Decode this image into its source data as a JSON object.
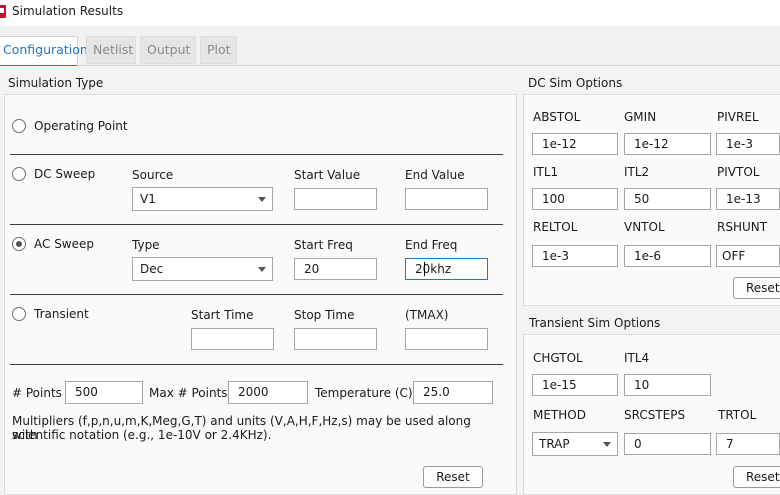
{
  "window": {
    "title": "Simulation Results"
  },
  "tabs": [
    "Configuration",
    "Netlist",
    "Output",
    "Plot"
  ],
  "sim_type": {
    "heading": "Simulation Type",
    "op_point": {
      "label": "Operating Point"
    },
    "dc_sweep": {
      "label": "DC Sweep",
      "source_label": "Source",
      "source_value": "V1",
      "start_label": "Start Value",
      "start_value": "",
      "end_label": "End Value",
      "end_value": ""
    },
    "ac_sweep": {
      "label": "AC Sweep",
      "selected": true,
      "type_label": "Type",
      "type_value": "Dec",
      "start_label": "Start Freq",
      "start_value": "20",
      "end_label": "End Freq",
      "end_value": "20khz"
    },
    "transient": {
      "label": "Transient",
      "start_label": "Start Time",
      "start_value": "",
      "stop_label": "Stop Time",
      "stop_value": "",
      "tmax_label": "(TMAX)",
      "tmax_value": ""
    },
    "points_label": "# Points",
    "points_value": "500",
    "max_points_label": "Max # Points",
    "max_points_value": "2000",
    "temperature_label": "Temperature (C)",
    "temperature_value": "25.0",
    "note_line1": "Multipliers (f,p,n,u,m,K,Meg,G,T) and units (V,A,H,F,Hz,s) may be used along with",
    "note_line2": "scientific notation (e.g., 1e-10V or 2.4KHz).",
    "reset_label": "Reset"
  },
  "dc_options": {
    "heading": "DC Sim Options",
    "abstol_label": "ABSTOL",
    "abstol_value": "1e-12",
    "gmin_label": "GMIN",
    "gmin_value": "1e-12",
    "pivrel_label": "PIVREL",
    "pivrel_value": "1e-3",
    "itl1_label": "ITL1",
    "itl1_value": "100",
    "itl2_label": "ITL2",
    "itl2_value": "50",
    "pivtol_label": "PIVTOL",
    "pivtol_value": "1e-13",
    "reltol_label": "RELTOL",
    "reltol_value": "1e-3",
    "vntol_label": "VNTOL",
    "vntol_value": "1e-6",
    "rshunt_label": "RSHUNT",
    "rshunt_value": "OFF",
    "reset_label": "Reset"
  },
  "tran_options": {
    "heading": "Transient Sim Options",
    "chgtol_label": "CHGTOL",
    "chgtol_value": "1e-15",
    "itl4_label": "ITL4",
    "itl4_value": "10",
    "method_label": "METHOD",
    "method_value": "TRAP",
    "srcsteps_label": "SRCSTEPS",
    "srcsteps_value": "0",
    "trtol_label": "TRTOL",
    "trtol_value": "7",
    "reset_label": "Reset"
  },
  "colors": {
    "accent": "#1d78c1",
    "app_icon": "#c8102e"
  }
}
